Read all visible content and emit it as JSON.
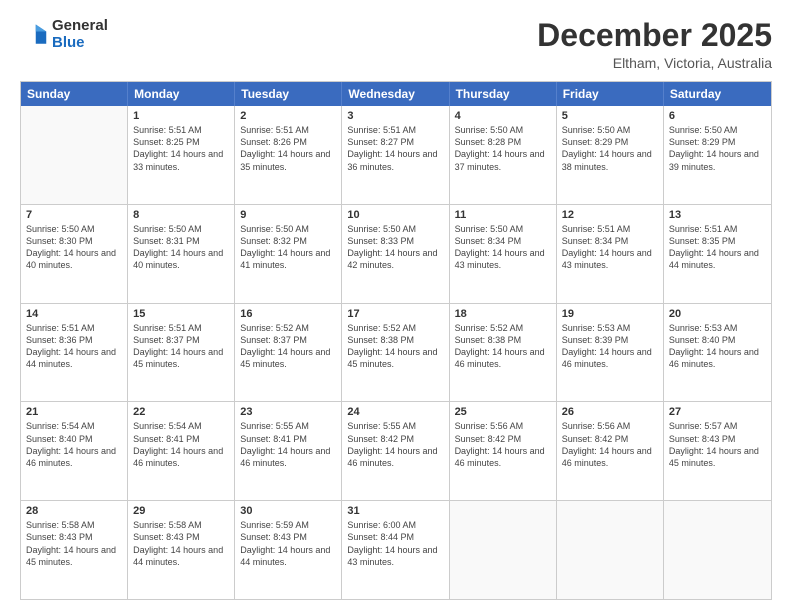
{
  "header": {
    "logo_general": "General",
    "logo_blue": "Blue",
    "month_title": "December 2025",
    "location": "Eltham, Victoria, Australia"
  },
  "calendar": {
    "days_of_week": [
      "Sunday",
      "Monday",
      "Tuesday",
      "Wednesday",
      "Thursday",
      "Friday",
      "Saturday"
    ],
    "weeks": [
      [
        {
          "day": "",
          "sunrise": "",
          "sunset": "",
          "daylight": ""
        },
        {
          "day": "1",
          "sunrise": "5:51 AM",
          "sunset": "8:25 PM",
          "daylight": "14 hours and 33 minutes."
        },
        {
          "day": "2",
          "sunrise": "5:51 AM",
          "sunset": "8:26 PM",
          "daylight": "14 hours and 35 minutes."
        },
        {
          "day": "3",
          "sunrise": "5:51 AM",
          "sunset": "8:27 PM",
          "daylight": "14 hours and 36 minutes."
        },
        {
          "day": "4",
          "sunrise": "5:50 AM",
          "sunset": "8:28 PM",
          "daylight": "14 hours and 37 minutes."
        },
        {
          "day": "5",
          "sunrise": "5:50 AM",
          "sunset": "8:29 PM",
          "daylight": "14 hours and 38 minutes."
        },
        {
          "day": "6",
          "sunrise": "5:50 AM",
          "sunset": "8:29 PM",
          "daylight": "14 hours and 39 minutes."
        }
      ],
      [
        {
          "day": "7",
          "sunrise": "5:50 AM",
          "sunset": "8:30 PM",
          "daylight": "14 hours and 40 minutes."
        },
        {
          "day": "8",
          "sunrise": "5:50 AM",
          "sunset": "8:31 PM",
          "daylight": "14 hours and 40 minutes."
        },
        {
          "day": "9",
          "sunrise": "5:50 AM",
          "sunset": "8:32 PM",
          "daylight": "14 hours and 41 minutes."
        },
        {
          "day": "10",
          "sunrise": "5:50 AM",
          "sunset": "8:33 PM",
          "daylight": "14 hours and 42 minutes."
        },
        {
          "day": "11",
          "sunrise": "5:50 AM",
          "sunset": "8:34 PM",
          "daylight": "14 hours and 43 minutes."
        },
        {
          "day": "12",
          "sunrise": "5:51 AM",
          "sunset": "8:34 PM",
          "daylight": "14 hours and 43 minutes."
        },
        {
          "day": "13",
          "sunrise": "5:51 AM",
          "sunset": "8:35 PM",
          "daylight": "14 hours and 44 minutes."
        }
      ],
      [
        {
          "day": "14",
          "sunrise": "5:51 AM",
          "sunset": "8:36 PM",
          "daylight": "14 hours and 44 minutes."
        },
        {
          "day": "15",
          "sunrise": "5:51 AM",
          "sunset": "8:37 PM",
          "daylight": "14 hours and 45 minutes."
        },
        {
          "day": "16",
          "sunrise": "5:52 AM",
          "sunset": "8:37 PM",
          "daylight": "14 hours and 45 minutes."
        },
        {
          "day": "17",
          "sunrise": "5:52 AM",
          "sunset": "8:38 PM",
          "daylight": "14 hours and 45 minutes."
        },
        {
          "day": "18",
          "sunrise": "5:52 AM",
          "sunset": "8:38 PM",
          "daylight": "14 hours and 46 minutes."
        },
        {
          "day": "19",
          "sunrise": "5:53 AM",
          "sunset": "8:39 PM",
          "daylight": "14 hours and 46 minutes."
        },
        {
          "day": "20",
          "sunrise": "5:53 AM",
          "sunset": "8:40 PM",
          "daylight": "14 hours and 46 minutes."
        }
      ],
      [
        {
          "day": "21",
          "sunrise": "5:54 AM",
          "sunset": "8:40 PM",
          "daylight": "14 hours and 46 minutes."
        },
        {
          "day": "22",
          "sunrise": "5:54 AM",
          "sunset": "8:41 PM",
          "daylight": "14 hours and 46 minutes."
        },
        {
          "day": "23",
          "sunrise": "5:55 AM",
          "sunset": "8:41 PM",
          "daylight": "14 hours and 46 minutes."
        },
        {
          "day": "24",
          "sunrise": "5:55 AM",
          "sunset": "8:42 PM",
          "daylight": "14 hours and 46 minutes."
        },
        {
          "day": "25",
          "sunrise": "5:56 AM",
          "sunset": "8:42 PM",
          "daylight": "14 hours and 46 minutes."
        },
        {
          "day": "26",
          "sunrise": "5:56 AM",
          "sunset": "8:42 PM",
          "daylight": "14 hours and 46 minutes."
        },
        {
          "day": "27",
          "sunrise": "5:57 AM",
          "sunset": "8:43 PM",
          "daylight": "14 hours and 45 minutes."
        }
      ],
      [
        {
          "day": "28",
          "sunrise": "5:58 AM",
          "sunset": "8:43 PM",
          "daylight": "14 hours and 45 minutes."
        },
        {
          "day": "29",
          "sunrise": "5:58 AM",
          "sunset": "8:43 PM",
          "daylight": "14 hours and 44 minutes."
        },
        {
          "day": "30",
          "sunrise": "5:59 AM",
          "sunset": "8:43 PM",
          "daylight": "14 hours and 44 minutes."
        },
        {
          "day": "31",
          "sunrise": "6:00 AM",
          "sunset": "8:44 PM",
          "daylight": "14 hours and 43 minutes."
        },
        {
          "day": "",
          "sunrise": "",
          "sunset": "",
          "daylight": ""
        },
        {
          "day": "",
          "sunrise": "",
          "sunset": "",
          "daylight": ""
        },
        {
          "day": "",
          "sunrise": "",
          "sunset": "",
          "daylight": ""
        }
      ]
    ]
  }
}
